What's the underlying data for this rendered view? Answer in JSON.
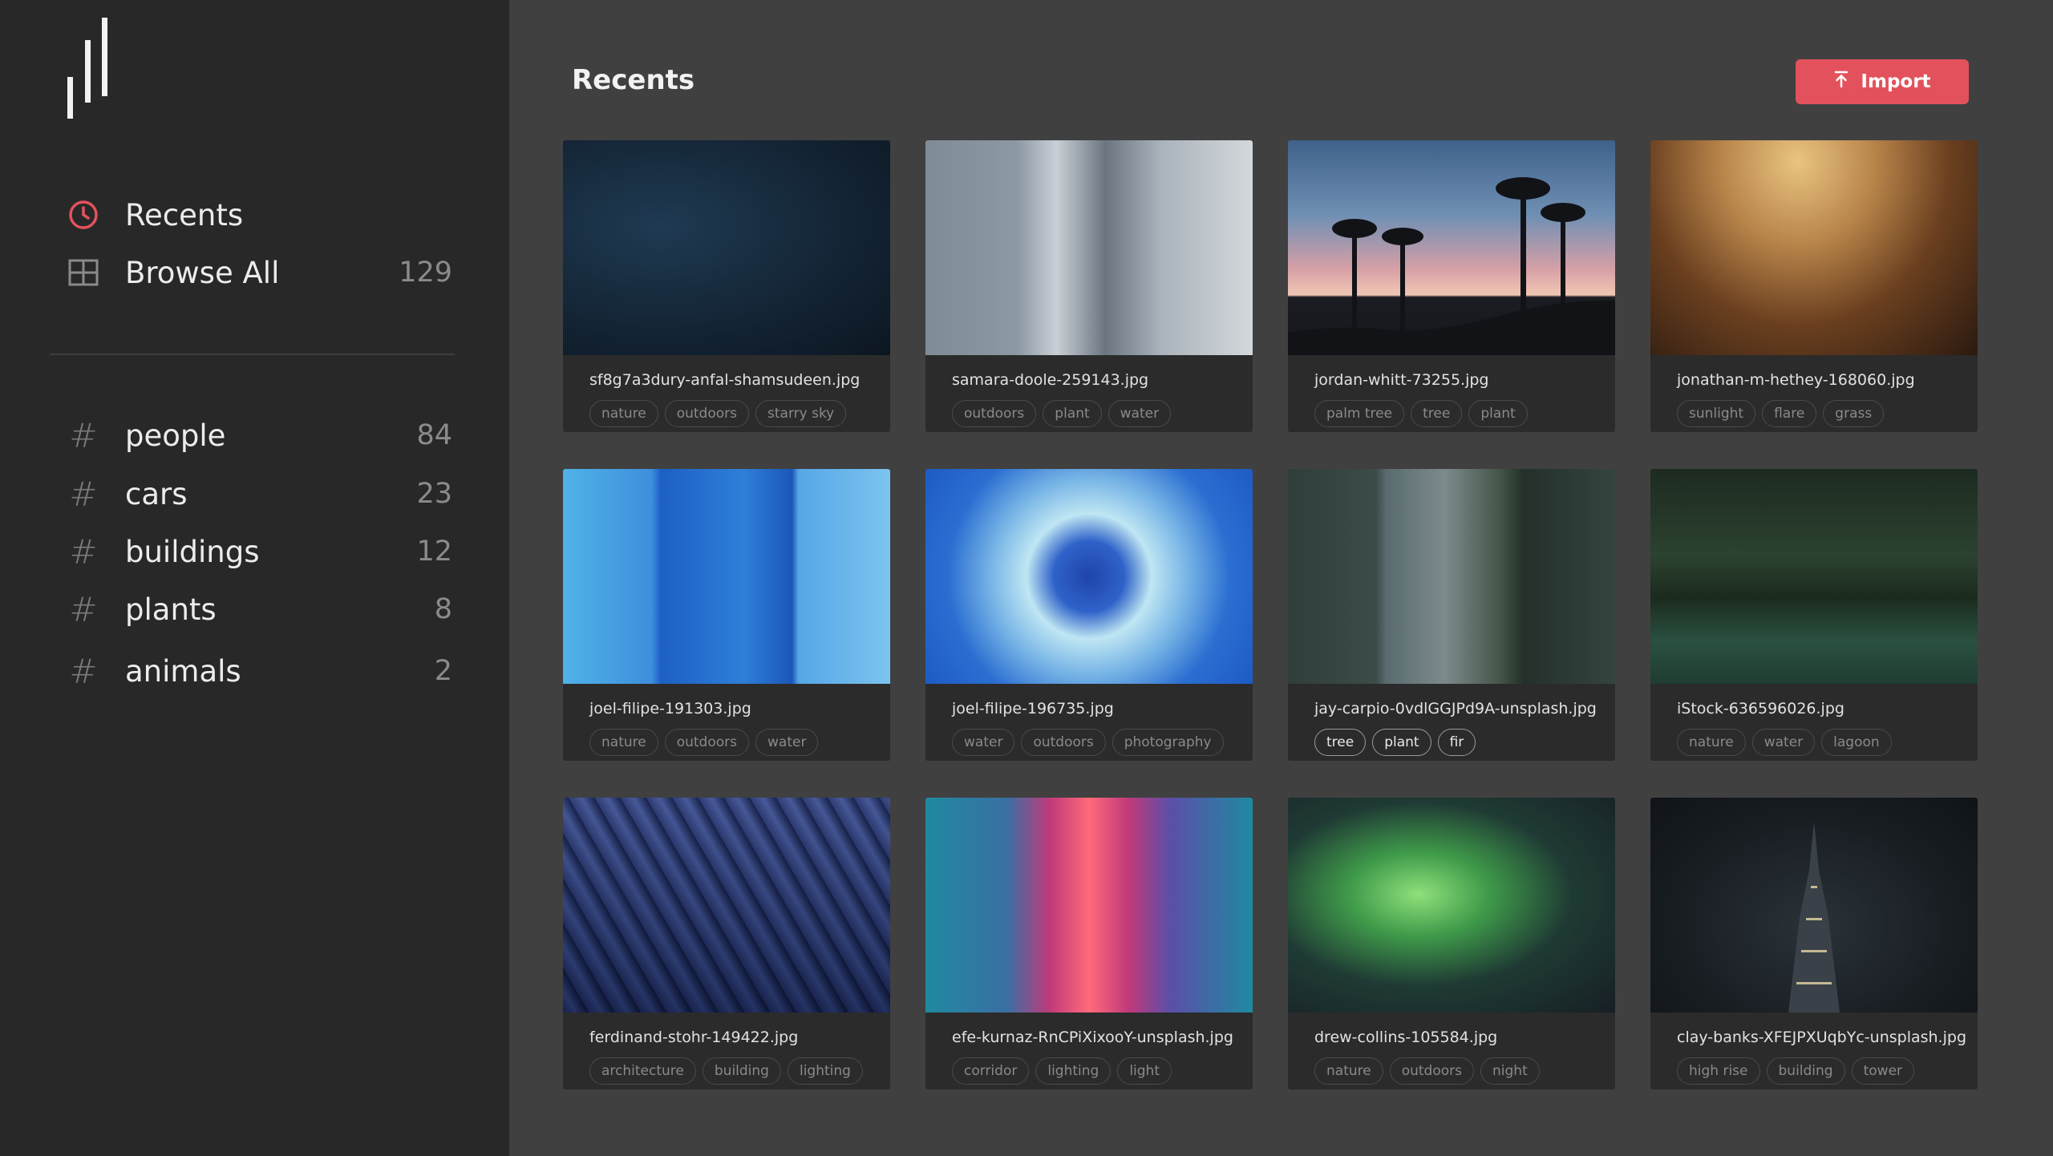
{
  "app": {
    "accent_color": "#e3525c",
    "logo_icon": "brand-logo-icon"
  },
  "sidebar": {
    "nav": [
      {
        "label": "Recents",
        "icon": "clock-icon",
        "count": ""
      },
      {
        "label": "Browse All",
        "icon": "grid-icon",
        "count": "129"
      }
    ],
    "tags": [
      {
        "label": "people",
        "count": "84"
      },
      {
        "label": "cars",
        "count": "23"
      },
      {
        "label": "buildings",
        "count": "12"
      },
      {
        "label": "plants",
        "count": "8"
      },
      {
        "label": "animals",
        "count": "2"
      }
    ]
  },
  "main": {
    "title": "Recents",
    "import_label": "Import",
    "import_icon": "upload-icon"
  },
  "images": [
    {
      "filename": "sf8g7a3dury-anfal-shamsudeen.jpg",
      "tags": [
        "nature",
        "outdoors",
        "starry sky"
      ]
    },
    {
      "filename": "samara-doole-259143.jpg",
      "tags": [
        "outdoors",
        "plant",
        "water"
      ]
    },
    {
      "filename": "jordan-whitt-73255.jpg",
      "tags": [
        "palm tree",
        "tree",
        "plant"
      ]
    },
    {
      "filename": "jonathan-m-hethey-168060.jpg",
      "tags": [
        "sunlight",
        "flare",
        "grass"
      ]
    },
    {
      "filename": "joel-filipe-191303.jpg",
      "tags": [
        "nature",
        "outdoors",
        "water"
      ]
    },
    {
      "filename": "joel-filipe-196735.jpg",
      "tags": [
        "water",
        "outdoors",
        "photography"
      ]
    },
    {
      "filename": "jay-carpio-0vdlGGJPd9A-unsplash.jpg",
      "tags": [
        "tree",
        "plant",
        "fir"
      ],
      "selected_tags": true
    },
    {
      "filename": "iStock-636596026.jpg",
      "tags": [
        "nature",
        "water",
        "lagoon"
      ]
    },
    {
      "filename": "ferdinand-stohr-149422.jpg",
      "tags": [
        "architecture",
        "building",
        "lighting"
      ]
    },
    {
      "filename": "efe-kurnaz-RnCPiXixooY-unsplash.jpg",
      "tags": [
        "corridor",
        "lighting",
        "light"
      ]
    },
    {
      "filename": "drew-collins-105584.jpg",
      "tags": [
        "nature",
        "outdoors",
        "night"
      ]
    },
    {
      "filename": "clay-banks-XFEJPXUqbYc-unsplash.jpg",
      "tags": [
        "high rise",
        "building",
        "tower"
      ]
    }
  ]
}
